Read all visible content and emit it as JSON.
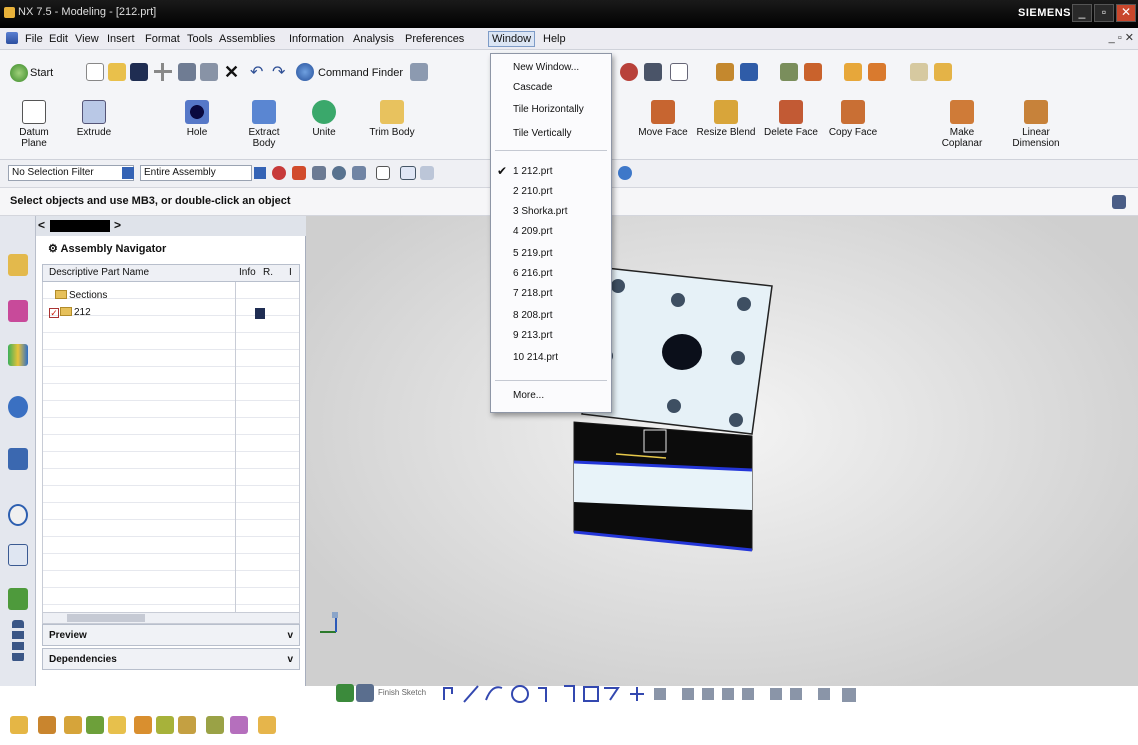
{
  "window": {
    "title": "NX 7.5 - Modeling - [212.prt]",
    "brand": "SIEMENS"
  },
  "menubar": {
    "items": [
      "File",
      "Edit",
      "View",
      "Insert",
      "Format",
      "Tools",
      "Assemblies",
      "Information",
      "Analysis",
      "Preferences",
      "Window",
      "Help"
    ],
    "active": "Window"
  },
  "toolbar": {
    "start_label": "Start",
    "command_finder_label": "Command Finder"
  },
  "ribbon": {
    "buttons": [
      {
        "label": "Datum Plane"
      },
      {
        "label": "Extrude"
      },
      {
        "label": "Hole"
      },
      {
        "label": "Extract Body"
      },
      {
        "label": "Unite"
      },
      {
        "label": "Trim Body"
      },
      {
        "label": "Move Face"
      },
      {
        "label": "Resize Blend"
      },
      {
        "label": "Delete Face"
      },
      {
        "label": "Copy Face"
      },
      {
        "label": "Make Coplanar"
      },
      {
        "label": "Linear Dimension"
      }
    ]
  },
  "selection_bar": {
    "filter": "No Selection Filter",
    "scope": "Entire Assembly"
  },
  "cue_line": "Select objects and use MB3, or double-click an object",
  "navigator": {
    "title": "Assembly Navigator",
    "columns": [
      "Descriptive Part Name",
      "Info",
      "R.",
      "I"
    ],
    "rows": [
      {
        "name": "Sections"
      },
      {
        "name": "212"
      }
    ],
    "panels": [
      "Preview",
      "Dependencies"
    ]
  },
  "window_menu": {
    "items": [
      "New Window...",
      "Cascade",
      "Tile Horizontally",
      "Tile Vertically"
    ],
    "recent": [
      "1 212.prt",
      "2 210.prt",
      "3 Shorka.prt",
      "4 209.prt",
      "5 219.prt",
      "6 216.prt",
      "7 218.prt",
      "8 208.prt",
      "9 213.prt",
      "10 214.prt"
    ],
    "more": "More..."
  },
  "sketch_bar": {
    "finish_label": "Finish Sketch"
  }
}
